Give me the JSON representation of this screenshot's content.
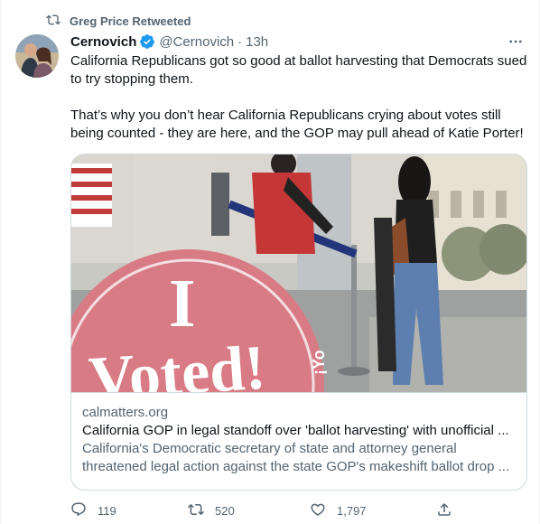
{
  "retweet": {
    "label": "Greg Price Retweeted",
    "icon": "retweet-icon"
  },
  "author": {
    "name": "Cernovich",
    "handle": "@Cernovich",
    "separator": "·",
    "time": "13h",
    "verified": true
  },
  "tweet": {
    "paragraph1": "California Republicans got so good at ballot harvesting that Democrats sued to try stopping them.",
    "paragraph2": "That’s why you don’t hear California Republicans crying about votes still being counted - they are here, and the GOP may pull ahead of Katie Porter!"
  },
  "card": {
    "domain": "calmatters.org",
    "title": "California GOP in legal standoff over 'ballot harvesting' with unofficial ...",
    "description": "California's Democratic secretary of state and attorney general threatened legal action against the state GOP's makeshift ballot drop ...",
    "image_sign_text_1": "I",
    "image_sign_text_2": "Voted!",
    "image_sign_text_3": "¡Yo"
  },
  "actions": {
    "replies": "119",
    "retweets": "520",
    "likes": "1,797"
  },
  "colors": {
    "accent": "#1d9bf0",
    "text": "#0f1419",
    "secondary": "#536471",
    "border": "#cfd9de"
  }
}
